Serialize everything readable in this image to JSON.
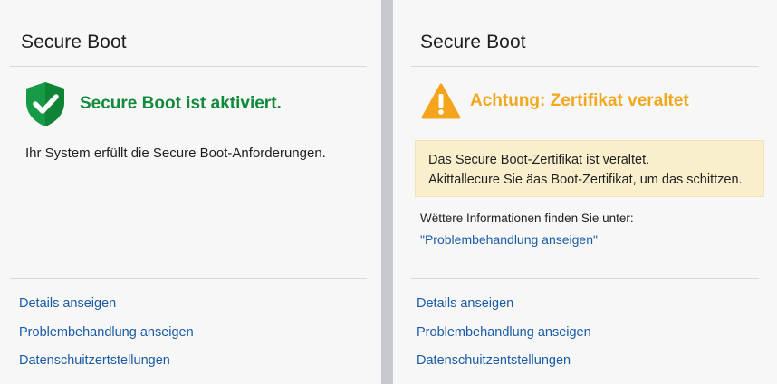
{
  "left_panel": {
    "title": "Secure Boot",
    "status_icon": "shield-check-icon",
    "status_text": "Secure Boot ist aktiviert.",
    "status_color": "#138a3b",
    "description": "Ihr System erfüllt die Secure Boot-Anforderungen.",
    "links": [
      "Details anseigen",
      "Problembehandlung anseigen",
      "Datenschuitzertstellungen"
    ]
  },
  "right_panel": {
    "title": "Secure Boot",
    "status_icon": "warning-triangle-icon",
    "status_text": "Achtung: Zertifikat veraltet",
    "status_color": "#f2a71c",
    "warning_box": {
      "line1": "Das Secure Boot-Zertifikat ist veraltet.",
      "line2": "Akittallecure Sie äas Boot-Zertifikat, um das  schittzen.",
      "background": "#faefcd"
    },
    "info_text": "Wëttere Informationen finden Sie unter:",
    "info_link": "\"Problembehandlung anseigen\"",
    "links": [
      "Details anseigen",
      "Problembehandlung anseigen",
      "Datenschuitzentstellungen"
    ]
  },
  "colors": {
    "link": "#1a5ba6",
    "divider": "#d9d9dc",
    "backdrop": "#c8c9cd"
  }
}
